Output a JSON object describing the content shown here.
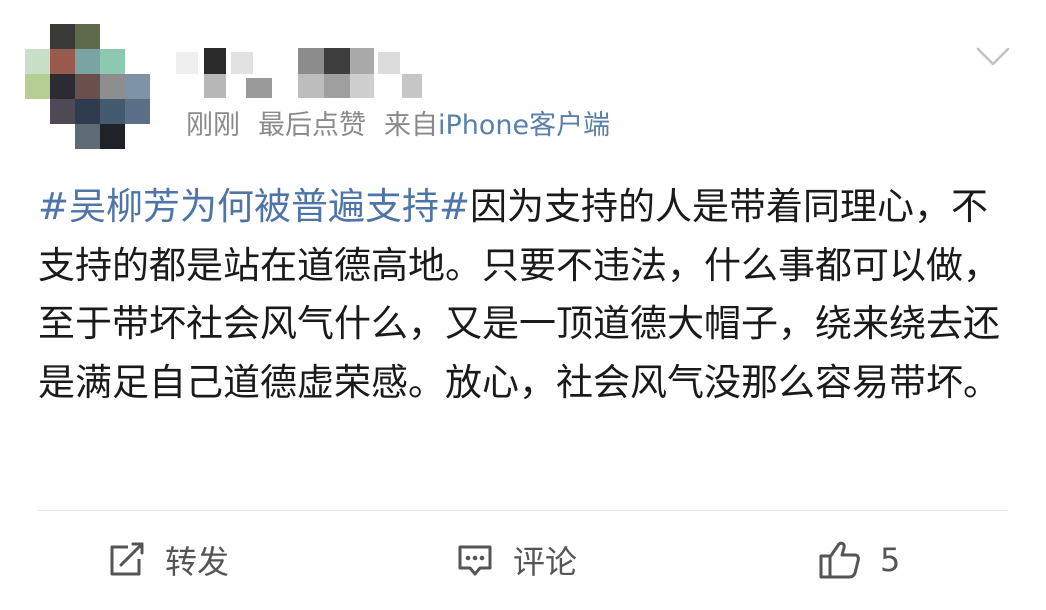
{
  "post": {
    "meta": {
      "time": "刚刚",
      "activity": "最后点赞",
      "source_prefix": "来自",
      "client": "iPhone客户端"
    },
    "topic": "#吴柳芳为何被普遍支持#",
    "body": "因为支持的人是带着同理心，不支持的都是站在道德高地。只要不违法，什么事都可以做，至于带坏社会风气什么，又是一顶道德大帽子，绕来绕去还是满足自己道德虚荣感。放心，社会风气没那么容易带坏。"
  },
  "actions": {
    "repost_label": "转发",
    "comment_label": "评论",
    "like_count": "5"
  },
  "icons": {
    "more": "chevron-down-icon",
    "repost": "repost-icon",
    "comment": "comment-icon",
    "like": "thumbs-up-icon"
  },
  "colors": {
    "topic": "#4f74a8",
    "meta": "#8a8a8a",
    "action": "#555555"
  }
}
